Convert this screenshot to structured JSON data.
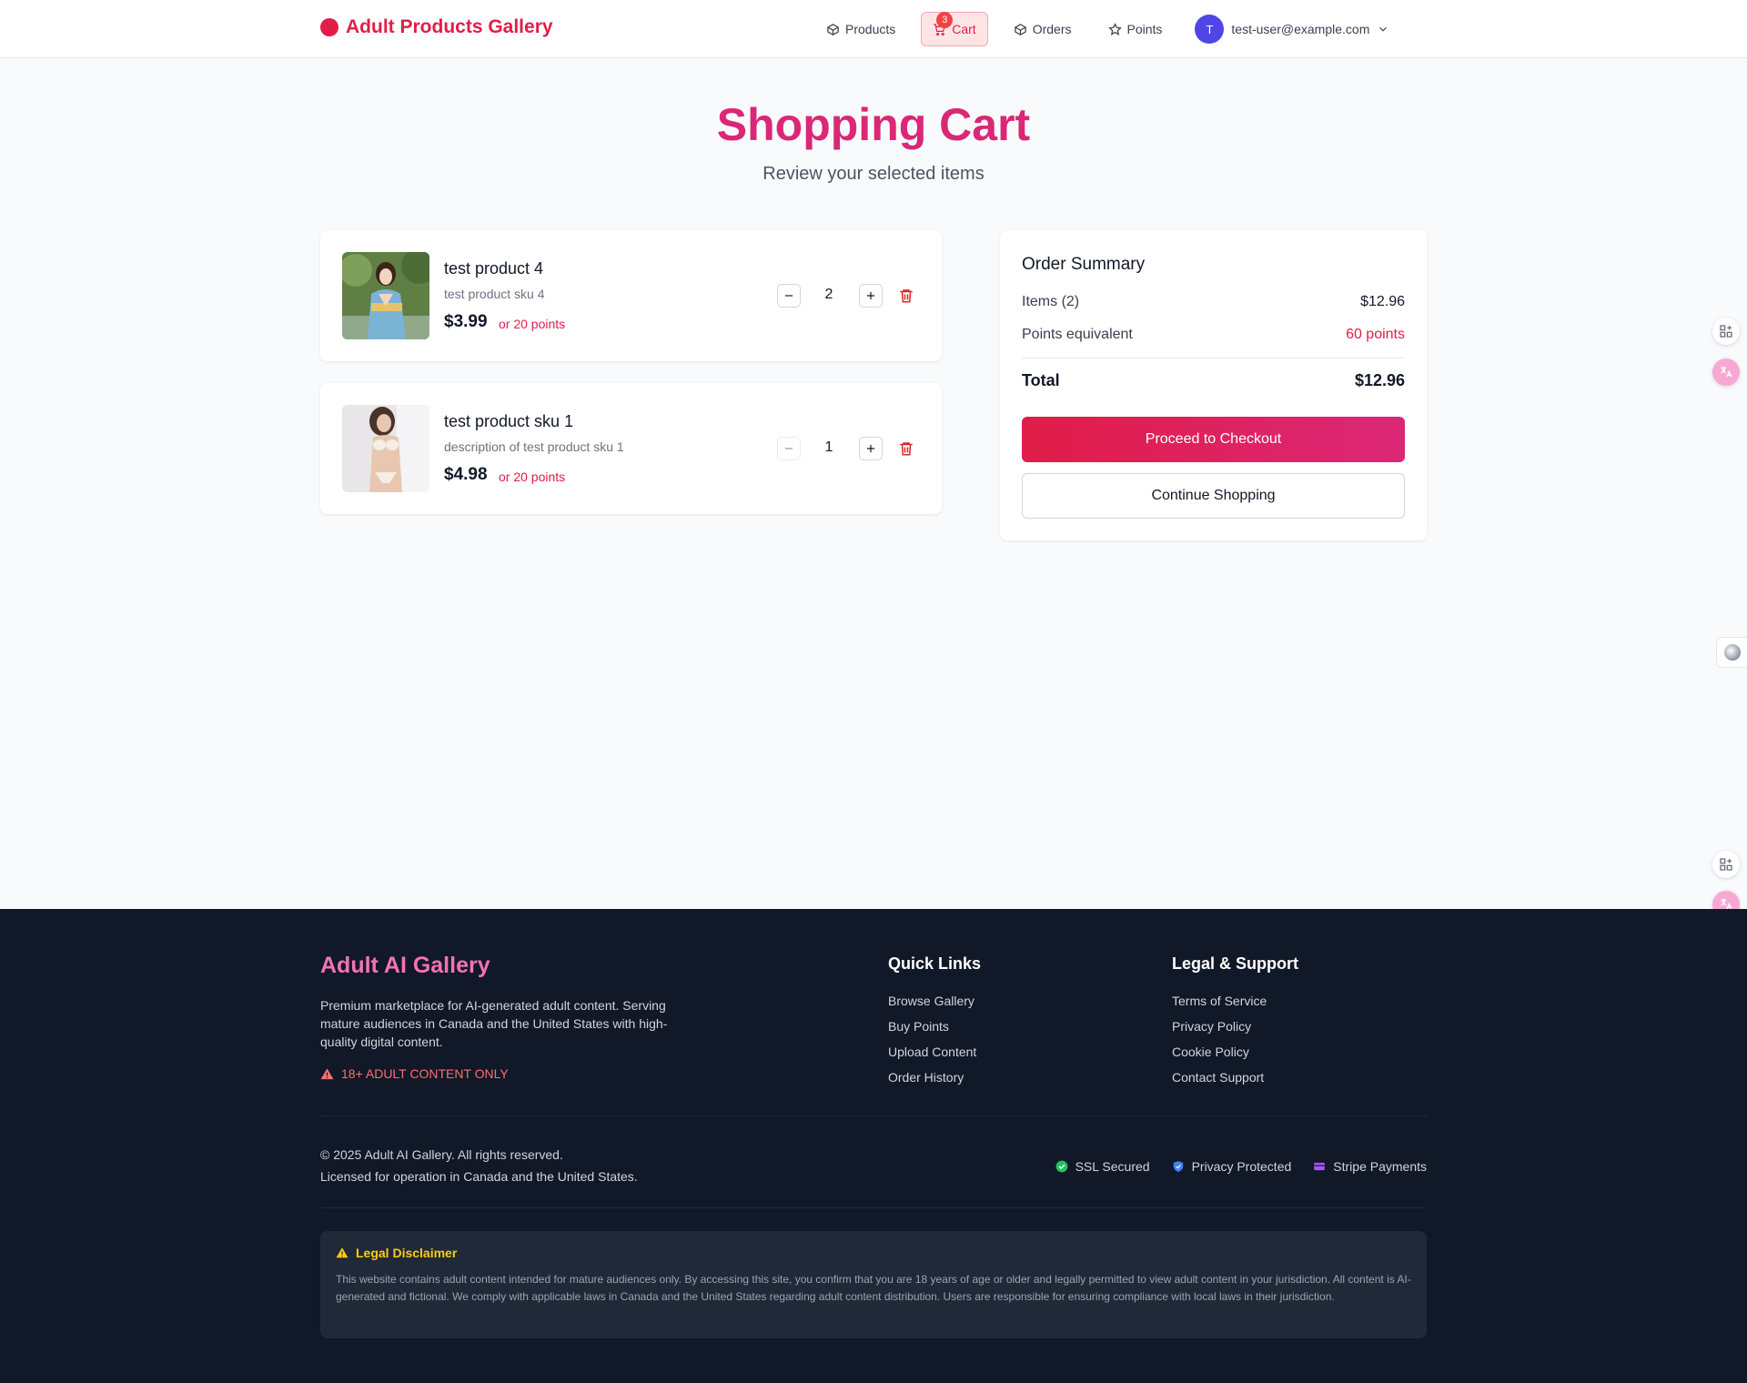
{
  "header": {
    "brand": "Adult Products Gallery",
    "nav": [
      {
        "label": "Products",
        "icon": "box-icon"
      },
      {
        "label": "Cart",
        "icon": "cart-icon",
        "badge": "3",
        "active": true
      },
      {
        "label": "Orders",
        "icon": "box-icon"
      },
      {
        "label": "Points",
        "icon": "star-icon"
      }
    ],
    "user": {
      "initial": "T",
      "email": "test-user@example.com"
    }
  },
  "page": {
    "title": "Shopping Cart",
    "subtitle": "Review your selected items"
  },
  "cart": {
    "items": [
      {
        "name": "test product 4",
        "description": "test product sku 4",
        "price": "$3.99",
        "points": "or 20 points",
        "quantity": "2",
        "image": "kimono-woman-photo"
      },
      {
        "name": "test product sku 1",
        "description": "description of test product sku 1",
        "price": "$4.98",
        "points": "or 20 points",
        "quantity": "1",
        "image": "lingerie-woman-photo"
      }
    ]
  },
  "summary": {
    "title": "Order Summary",
    "items_label": "Items (2)",
    "items_value": "$12.96",
    "points_label": "Points equivalent",
    "points_value": "60 points",
    "total_label": "Total",
    "total_value": "$12.96",
    "checkout_label": "Proceed to Checkout",
    "continue_label": "Continue Shopping"
  },
  "footer": {
    "brand": "Adult AI Gallery",
    "description": "Premium marketplace for AI-generated adult content. Serving mature audiences in Canada and the United States with high-quality digital content.",
    "warning": "18+ ADULT CONTENT ONLY",
    "quick_links_title": "Quick Links",
    "quick_links": [
      "Browse Gallery",
      "Buy Points",
      "Upload Content",
      "Order History"
    ],
    "legal_title": "Legal & Support",
    "legal_links": [
      "Terms of Service",
      "Privacy Policy",
      "Cookie Policy",
      "Contact Support"
    ],
    "copyright": "© 2025 Adult AI Gallery. All rights reserved.",
    "license": "Licensed for operation in Canada and the United States.",
    "badges": [
      "SSL Secured",
      "Privacy Protected",
      "Stripe Payments"
    ],
    "disclaimer_title": "Legal Disclaimer",
    "disclaimer_text": "This website contains adult content intended for mature audiences only. By accessing this site, you confirm that you are 18 years of age or older and legally permitted to view adult content in your jurisdiction. All content is AI-generated and fictional. We comply with applicable laws in Canada and the United States regarding adult content distribution. Users are responsible for ensuring compliance with local laws in their jurisdiction."
  },
  "colors": {
    "brand": "#e11d48",
    "title_pink": "#db2777",
    "footer_bg": "#111827",
    "avatar": "#4f46e5"
  }
}
